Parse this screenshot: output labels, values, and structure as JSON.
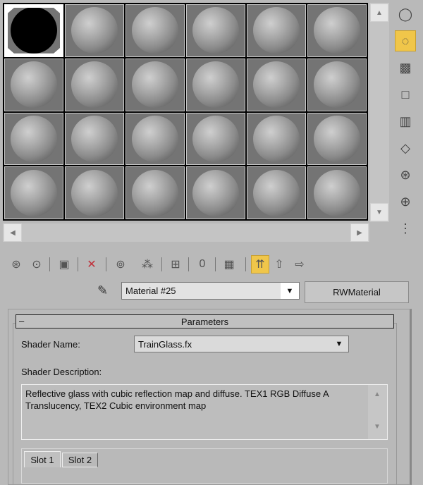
{
  "slots": {
    "count": 24,
    "selected": 0
  },
  "scroll": {
    "up": "▲",
    "down": "▼",
    "left": "◀",
    "right": "▶"
  },
  "side_tools": [
    {
      "name": "sample-type-icon",
      "glyph": "◯",
      "active": false
    },
    {
      "name": "backlight-icon",
      "glyph": "◌",
      "active": true
    },
    {
      "name": "background-checker-icon",
      "glyph": "▩",
      "active": false
    },
    {
      "name": "sample-uv-tiling-icon",
      "glyph": "□",
      "active": false
    },
    {
      "name": "video-color-check-icon",
      "glyph": "▥",
      "active": false
    },
    {
      "name": "make-preview-icon",
      "glyph": "◇",
      "active": false
    },
    {
      "name": "options-icon",
      "glyph": "⊛",
      "active": false
    },
    {
      "name": "select-by-material-icon",
      "glyph": "⊕",
      "active": false
    },
    {
      "name": "material-map-navigator-icon",
      "glyph": "⋮",
      "active": false
    }
  ],
  "toolbar": [
    {
      "name": "get-material-icon",
      "glyph": "⊛",
      "active": false
    },
    {
      "name": "put-material-to-scene-icon",
      "glyph": "⊙",
      "active": false
    },
    {
      "name": "assign-material-to-selection-icon",
      "glyph": "▣",
      "active": false
    },
    {
      "name": "reset-map-icon",
      "glyph": "✕",
      "active": false,
      "color": "#c0303a"
    },
    {
      "name": "make-material-copy-icon",
      "glyph": "⊚",
      "active": false
    },
    {
      "name": "make-unique-icon",
      "glyph": "⁂",
      "active": false
    },
    {
      "name": "put-to-library-icon",
      "glyph": "⊞",
      "active": false
    },
    {
      "name": "material-id-channel-icon",
      "glyph": "0",
      "active": false
    },
    {
      "name": "show-map-in-viewport-icon",
      "glyph": "▦",
      "active": false
    },
    {
      "name": "show-end-result-icon",
      "glyph": "⇈",
      "active": true
    },
    {
      "name": "go-to-parent-icon",
      "glyph": "⇧",
      "active": false
    },
    {
      "name": "go-forward-to-sibling-icon",
      "glyph": "⇨",
      "active": false
    }
  ],
  "material": {
    "name": "Material #25",
    "type_button": "RWMaterial"
  },
  "rollout": {
    "collapse": "–",
    "title": "Parameters",
    "shader_name_label": "Shader Name:",
    "shader_name": "TrainGlass.fx",
    "shader_desc_label": "Shader Description:",
    "shader_desc": "Reflective glass with cubic reflection map and diffuse. TEX1 RGB Diffuse A Translucency, TEX2 Cubic environment map",
    "tabs": [
      "Slot 1",
      "Slot 2"
    ],
    "active_tab": 0
  }
}
